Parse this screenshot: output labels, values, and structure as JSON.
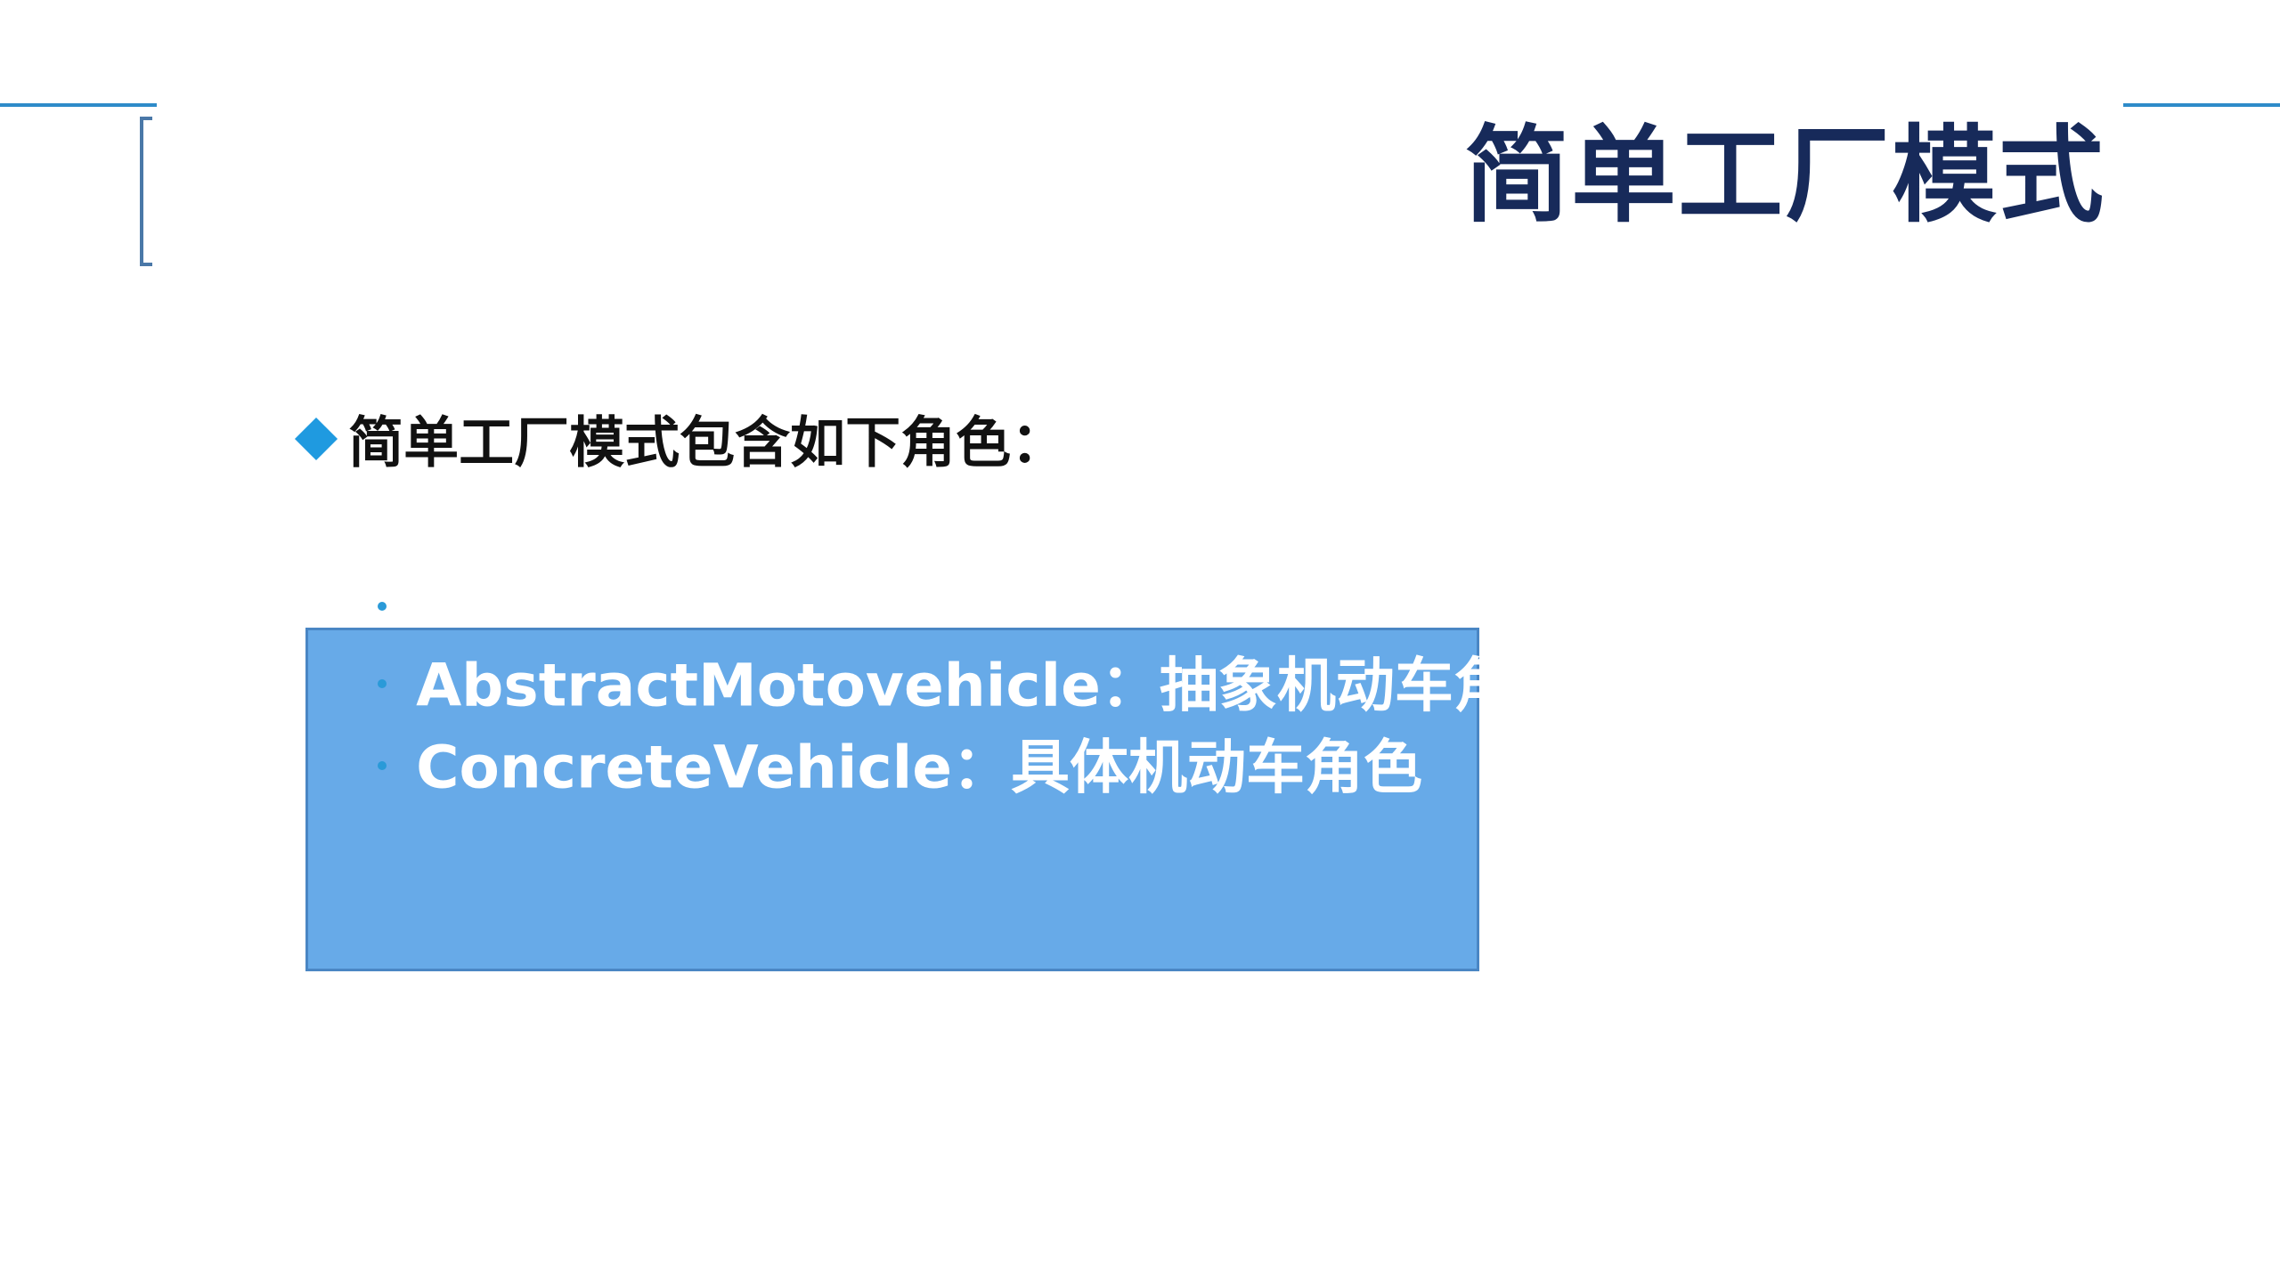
{
  "slide": {
    "title": "简单工厂模式",
    "heading": "简单工厂模式包含如下角色：",
    "items": [
      {
        "text": "AbstractMotovehicle：抽象机动车角色"
      },
      {
        "text": "ConcreteVehicle：具体机动车角色"
      }
    ]
  },
  "colors": {
    "accent_line": "#2e8bc9",
    "title": "#172a5a",
    "diamond": "#1f9ae0",
    "box_fill": "#67aae8",
    "box_border": "#4a86c4",
    "item_text": "#ffffff"
  }
}
